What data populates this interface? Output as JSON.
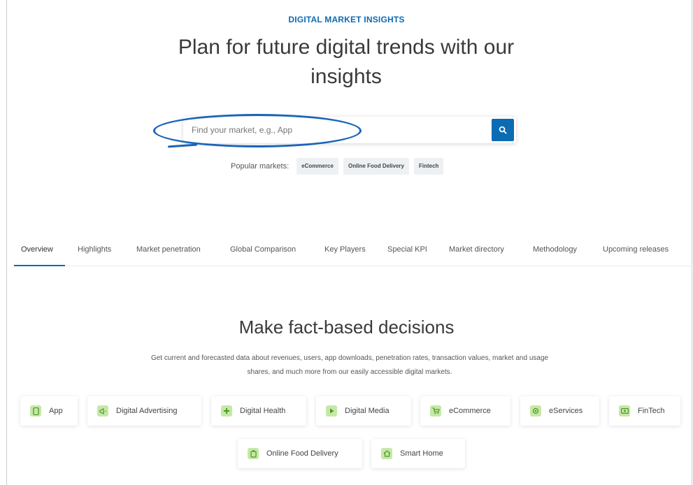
{
  "eyebrow": "DIGITAL MARKET INSIGHTS",
  "headline": "Plan for future digital trends with our insights",
  "search": {
    "placeholder": "Find your market, e.g., App",
    "button_icon": "search-icon"
  },
  "popular": {
    "label": "Popular markets:",
    "chips": [
      "eCommerce",
      "Online Food Delivery",
      "Fintech"
    ]
  },
  "tabs": [
    "Overview",
    "Highlights",
    "Market penetration",
    "Global Comparison",
    "Key Players",
    "Special KPI",
    "Market directory",
    "Methodology",
    "Upcoming releases"
  ],
  "active_tab": "Overview",
  "section": {
    "title": "Make fact-based decisions",
    "description": "Get current and forecasted data about revenues, users, app downloads, penetration rates, transaction values, market and usage shares, and much more from our easily accessible digital markets."
  },
  "markets": [
    {
      "label": "App",
      "icon": "app-icon"
    },
    {
      "label": "Digital Advertising",
      "icon": "megaphone-icon"
    },
    {
      "label": "Digital Health",
      "icon": "health-icon"
    },
    {
      "label": "Digital Media",
      "icon": "media-icon"
    },
    {
      "label": "eCommerce",
      "icon": "cart-icon"
    },
    {
      "label": "eServices",
      "icon": "service-icon"
    },
    {
      "label": "FinTech",
      "icon": "money-icon"
    },
    {
      "label": "Online Food Delivery",
      "icon": "food-icon"
    },
    {
      "label": "Smart Home",
      "icon": "home-icon"
    }
  ],
  "colors": {
    "accent": "#0b6bb3",
    "icon_bg": "#c6e8a6",
    "annotation": "#1a64b8"
  }
}
